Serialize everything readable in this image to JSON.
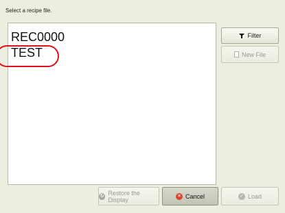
{
  "dialog": {
    "prompt": "Select a recipe file."
  },
  "files": [
    {
      "name": "REC0000"
    },
    {
      "name": "TEST"
    }
  ],
  "buttons": {
    "filter": "Filter",
    "new_file": "New File",
    "restore": "Restore the Display",
    "cancel": "Cancel",
    "load": "Load"
  },
  "icons": {
    "filter": "filter-icon",
    "new_file": "new-file-icon",
    "restore": "restore-icon",
    "cancel": "cancel-icon",
    "load": "load-icon"
  },
  "colors": {
    "highlight": "#e0101a",
    "cancel_icon": "#e0442e",
    "background": "#edeedf"
  }
}
